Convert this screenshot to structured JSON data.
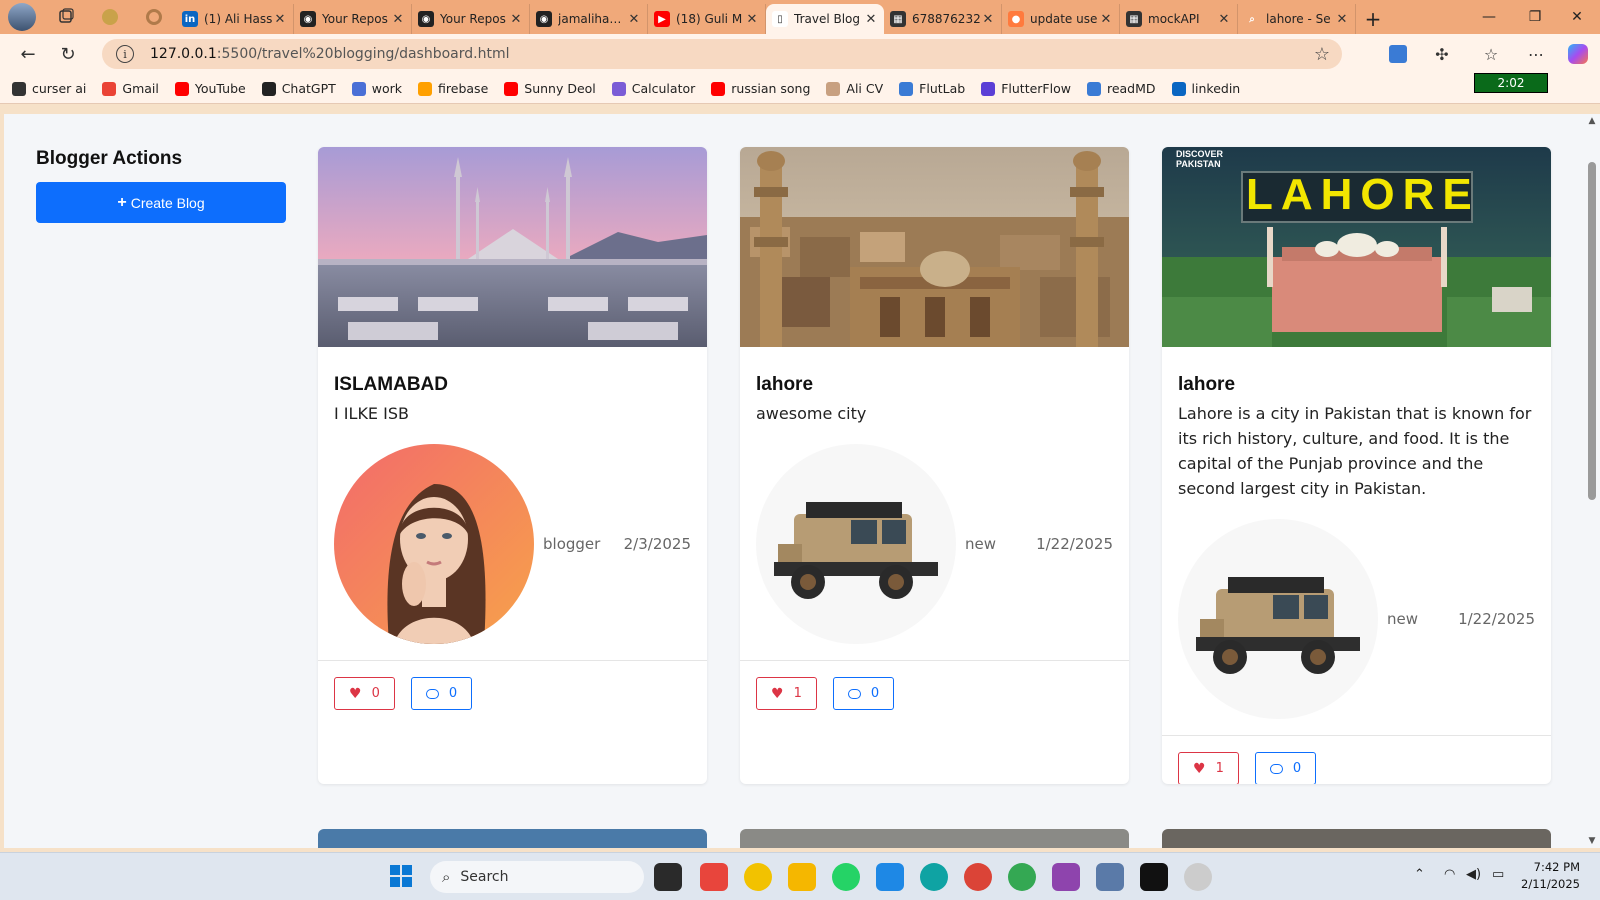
{
  "browser": {
    "tabs": [
      {
        "label": "(1) Ali Hass",
        "fav_color": "#0a66c2",
        "fav_glyph": "in"
      },
      {
        "label": "Your Repos",
        "fav_color": "#222222",
        "fav_glyph": "◉"
      },
      {
        "label": "Your Repos",
        "fav_color": "#222222",
        "fav_glyph": "◉"
      },
      {
        "label": "jamalihassa",
        "fav_color": "#222222",
        "fav_glyph": "◉"
      },
      {
        "label": "(18) Guli M",
        "fav_color": "#ff0000",
        "fav_glyph": "▶"
      },
      {
        "label": "Travel Blog",
        "fav_color": "#ffffff",
        "fav_glyph": "▯",
        "active": true
      },
      {
        "label": "678876232",
        "fav_color": "#333333",
        "fav_glyph": "▦"
      },
      {
        "label": "update use",
        "fav_color": "#ff7a3d",
        "fav_glyph": "●"
      },
      {
        "label": "mockAPI",
        "fav_color": "#333333",
        "fav_glyph": "▦"
      },
      {
        "label": "lahore - Se",
        "fav_color": "#f0a97a",
        "fav_glyph": "⌕"
      }
    ],
    "url_host": "127.0.0.1",
    "url_path": ":5500/travel%20blogging/dashboard.html",
    "bookmarks": [
      {
        "label": "curser ai",
        "color": "#333333"
      },
      {
        "label": "Gmail",
        "color": "#ea4335"
      },
      {
        "label": "YouTube",
        "color": "#ff0000"
      },
      {
        "label": "ChatGPT",
        "color": "#222222"
      },
      {
        "label": "work",
        "color": "#4a6fd6"
      },
      {
        "label": "firebase",
        "color": "#ffa000"
      },
      {
        "label": "Sunny Deol",
        "color": "#ff0000"
      },
      {
        "label": "Calculator",
        "color": "#7b5cd6"
      },
      {
        "label": "russian song",
        "color": "#ff0000"
      },
      {
        "label": "Ali CV",
        "color": "#c8a080"
      },
      {
        "label": "FlutLab",
        "color": "#3a7bd5"
      },
      {
        "label": "FlutterFlow",
        "color": "#5b3fd6"
      },
      {
        "label": "readMD",
        "color": "#3a7bd5"
      },
      {
        "label": "linkedin",
        "color": "#0a66c2"
      }
    ],
    "timer": "2:02"
  },
  "sidebar": {
    "title": "Blogger Actions",
    "create_icon": "+",
    "create_label": "Create Blog"
  },
  "posts": [
    {
      "image": "faisal-mosque",
      "title": "ISLAMABAD",
      "description": "I ILKE ISB",
      "author_avatar": "woman-portrait",
      "author": "blogger",
      "date": "2/3/2025",
      "likes": "0",
      "comments": "0"
    },
    {
      "image": "lahore-old-city",
      "title": "lahore",
      "description": "awesome city",
      "author_avatar": "off-road-suv",
      "author": "new",
      "date": "1/22/2025",
      "likes": "1",
      "comments": "0"
    },
    {
      "image": "lahore-badshahi-banner",
      "title": "lahore",
      "description": "Lahore is a city in Pakistan that is known for its rich history, culture, and food. It is the capital of the Punjab province and the second largest city in Pakistan.",
      "banner_text": "LAHORE",
      "banner_brand": "DISCOVER PAKISTAN",
      "author_avatar": "off-road-suv",
      "author": "new",
      "date": "1/22/2025",
      "likes": "1",
      "comments": "0"
    }
  ],
  "taskbar": {
    "search_placeholder": "Search",
    "time": "7:42 PM",
    "date": "2/11/2025"
  }
}
